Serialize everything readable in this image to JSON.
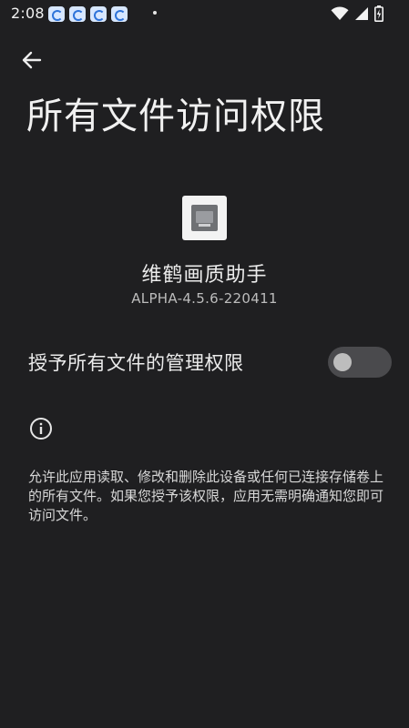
{
  "status_bar": {
    "time": "2:08",
    "notification_icons": [
      "app-notification-icon",
      "app-notification-icon",
      "app-notification-icon",
      "app-notification-icon"
    ],
    "system_icons": [
      "wifi-icon",
      "cell-signal-icon",
      "battery-charging-icon"
    ]
  },
  "app_bar": {
    "back_icon": "arrow-left-icon",
    "title": "所有文件访问权限"
  },
  "app_info": {
    "name": "维鹤画质助手",
    "version": "ALPHA-4.5.6-220411"
  },
  "setting": {
    "label": "授予所有文件的管理权限",
    "enabled": false
  },
  "info": {
    "icon": "info-icon",
    "description": "允许此应用读取、修改和删除此设备或任何已连接存储卷上的所有文件。如果您授予该权限，应用无需明确通知您即可访问文件。"
  },
  "colors": {
    "background": "#1f1f21",
    "text_primary": "#ececec",
    "text_secondary": "#bcbcbc",
    "switch_track_off": "#4a4a4d",
    "switch_thumb_off": "#bdbdbd"
  }
}
